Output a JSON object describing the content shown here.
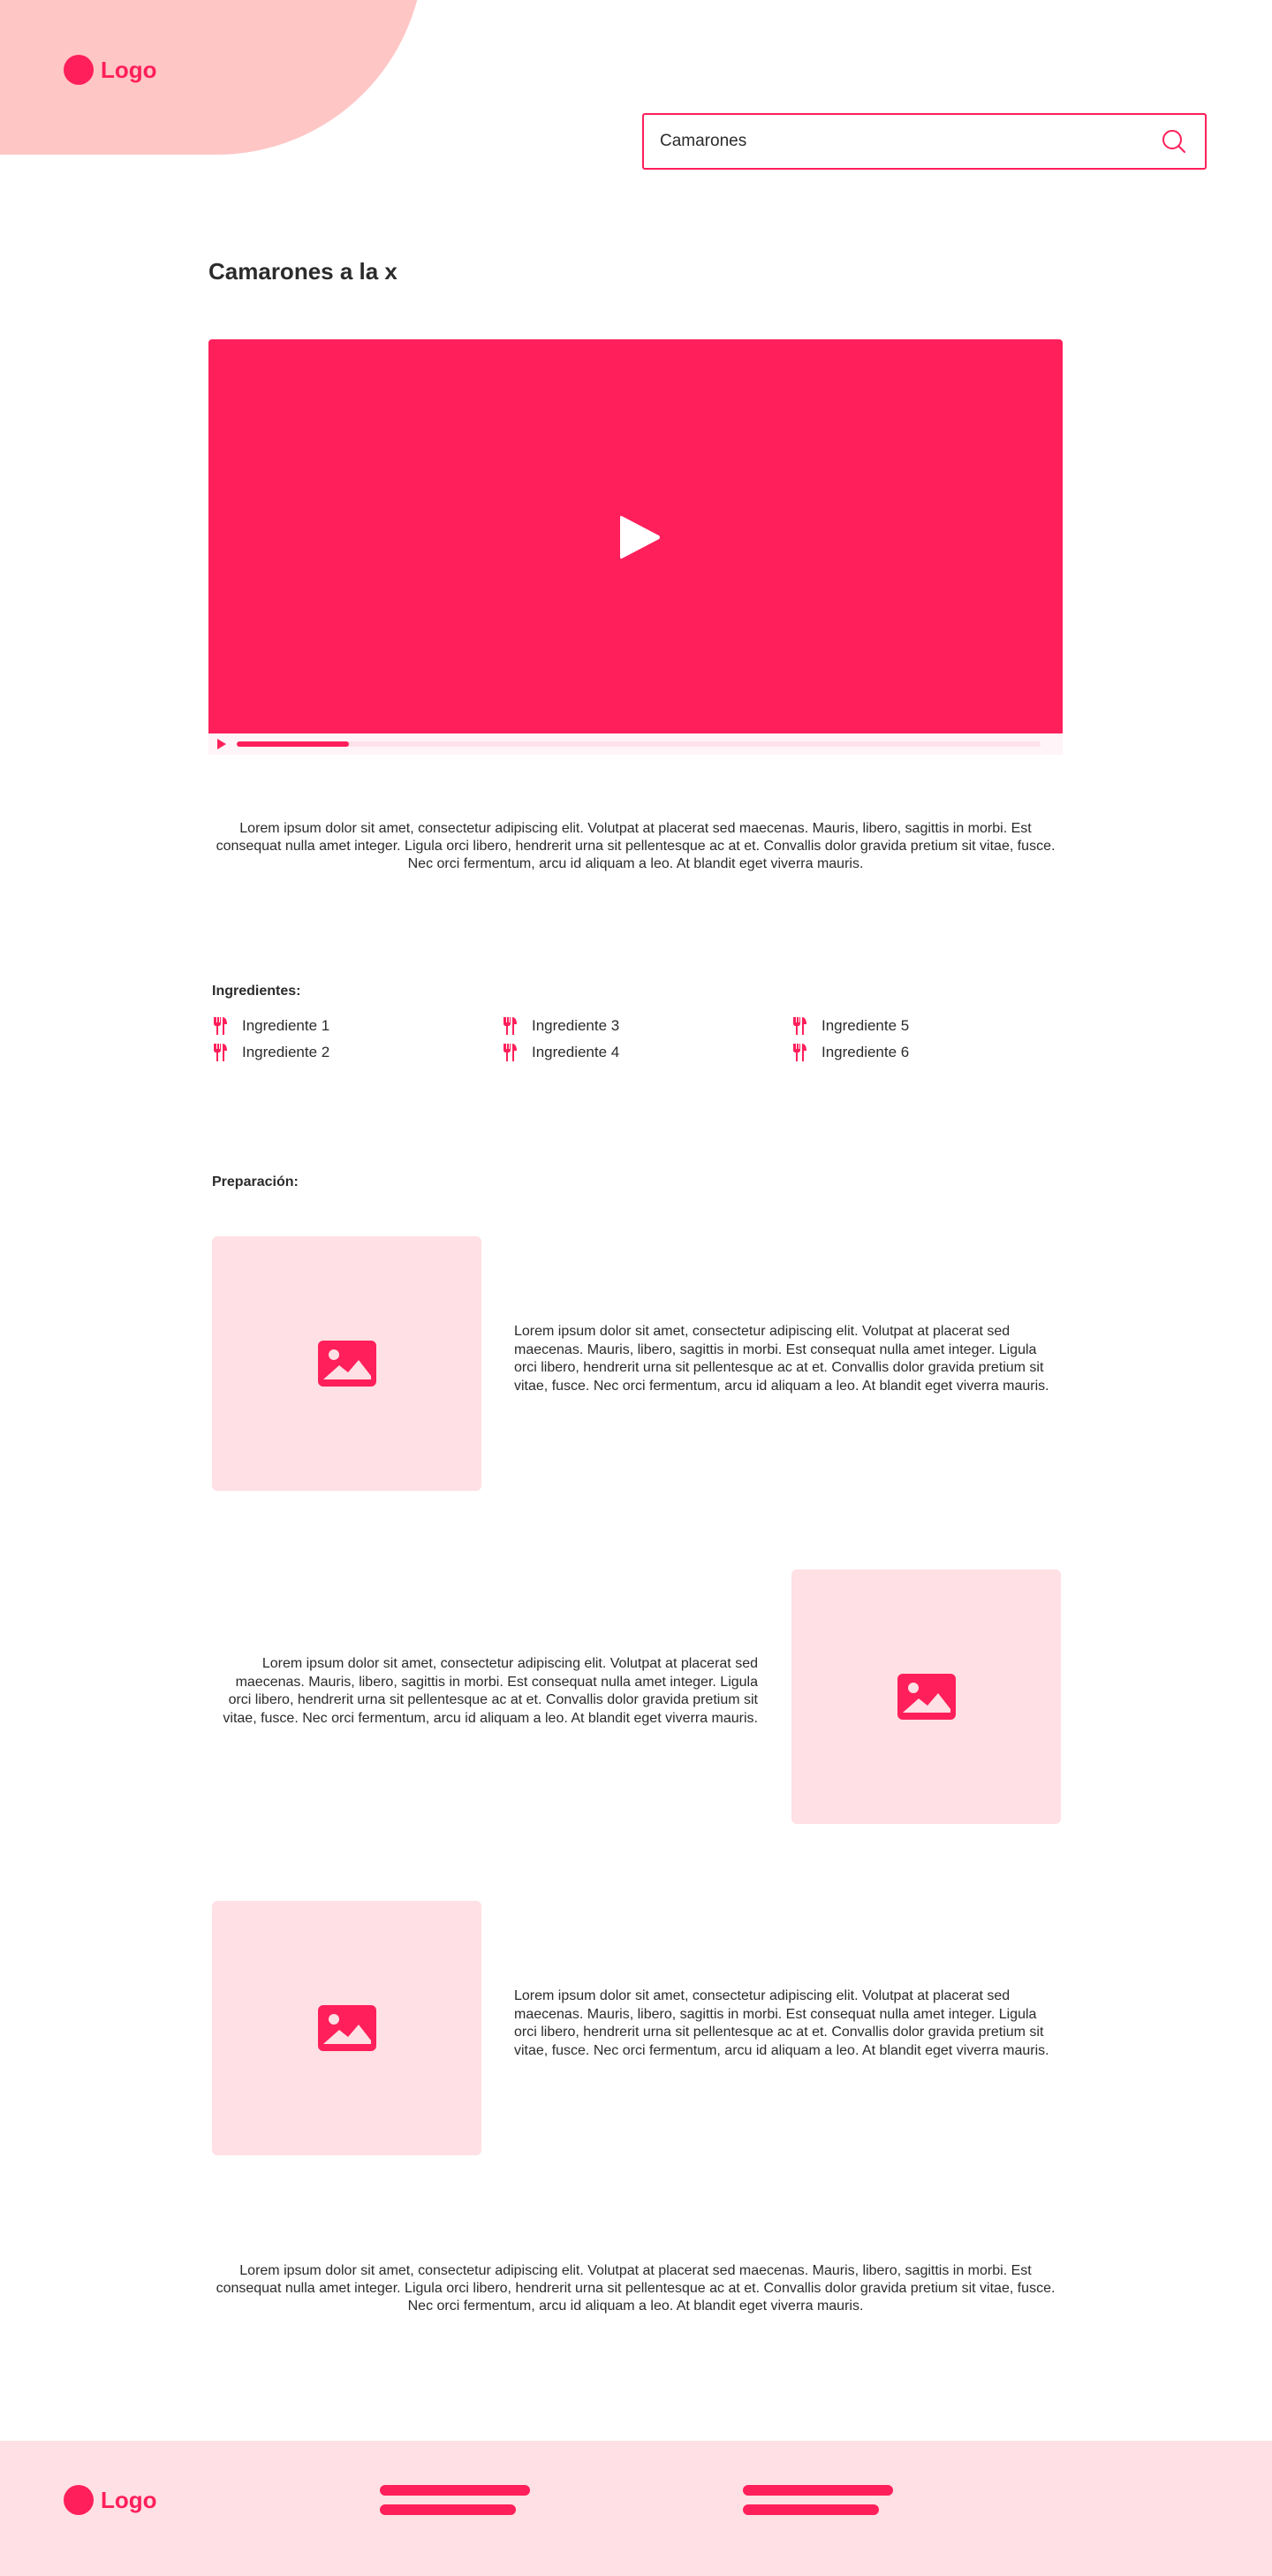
{
  "header": {
    "logo_text": "Logo",
    "search": {
      "value": "Camarones",
      "icon": "search-icon"
    }
  },
  "recipe": {
    "title": "Camarones a la x",
    "video": {
      "progress_fraction": 0.14
    },
    "intro": "Lorem ipsum dolor sit amet, consectetur adipiscing elit. Volutpat at placerat sed maecenas. Mauris, libero, sagittis in morbi. Est consequat nulla amet integer. Ligula orci libero, hendrerit urna sit pellentesque ac at et. Convallis dolor gravida pretium sit vitae, fusce. Nec orci fermentum, arcu id aliquam a leo. At blandit eget viverra mauris.",
    "ingredients_label": "Ingredientes:",
    "ingredients": [
      "Ingrediente 1",
      "Ingrediente 2",
      "Ingrediente 3",
      "Ingrediente 4",
      "Ingrediente 5",
      "Ingrediente 6"
    ],
    "preparation_label": "Preparación:",
    "steps": [
      {
        "text": "Lorem ipsum dolor sit amet, consectetur adipiscing elit. Volutpat at placerat sed maecenas. Mauris, libero, sagittis in morbi. Est consequat nulla amet integer. Ligula orci libero, hendrerit urna sit pellentesque ac at et. Convallis dolor gravida pretium sit vitae, fusce. Nec orci fermentum, arcu id aliquam a leo. At blandit eget viverra mauris."
      },
      {
        "text": "Lorem ipsum dolor sit amet, consectetur adipiscing elit. Volutpat at placerat sed maecenas. Mauris, libero, sagittis in morbi. Est consequat nulla amet integer. Ligula orci libero, hendrerit urna sit pellentesque ac at et. Convallis dolor gravida pretium sit vitae, fusce. Nec orci fermentum, arcu id aliquam a leo. At blandit eget viverra mauris."
      },
      {
        "text": "Lorem ipsum dolor sit amet, consectetur adipiscing elit. Volutpat at placerat sed maecenas. Mauris, libero, sagittis in morbi. Est consequat nulla amet integer. Ligula orci libero, hendrerit urna sit pellentesque ac at et. Convallis dolor gravida pretium sit vitae, fusce. Nec orci fermentum, arcu id aliquam a leo. At blandit eget viverra mauris."
      }
    ],
    "outro": "Lorem ipsum dolor sit amet, consectetur adipiscing elit. Volutpat at placerat sed maecenas. Mauris, libero, sagittis in morbi. Est consequat nulla amet integer. Ligula orci libero, hendrerit urna sit pellentesque ac at et. Convallis dolor gravida pretium sit vitae, fusce. Nec orci fermentum, arcu id aliquam a leo. At blandit eget viverra mauris."
  },
  "footer": {
    "logo_text": "Logo"
  },
  "colors": {
    "accent": "#ff1f5a",
    "blob": "#ffc6c6",
    "soft": "#ffe0e4"
  }
}
